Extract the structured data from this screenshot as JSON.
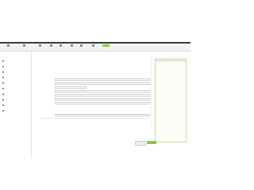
{
  "colors": {
    "accent": "#8cc63f",
    "header_strip": "#3a3a3a",
    "help_text": "#6a9a32",
    "help_border": "#c7dea6"
  },
  "toolbar": {
    "items": [
      {
        "label": "",
        "icon": "gear-icon"
      },
      {
        "label": "",
        "icon": "document-icon"
      },
      {
        "label": "",
        "icon": "calendar-icon"
      },
      {
        "label": "",
        "icon": "list-icon"
      },
      {
        "label": "",
        "icon": "folder-icon"
      },
      {
        "label": "",
        "icon": "chart-icon"
      },
      {
        "label": "",
        "icon": "plus-icon"
      },
      {
        "label": "",
        "icon": "user-icon"
      },
      {
        "label": "",
        "icon": "add-button-icon"
      }
    ]
  },
  "sidebar": {
    "title": "",
    "items": [
      {
        "label": ""
      },
      {
        "label": ""
      },
      {
        "label": ""
      },
      {
        "label": ""
      },
      {
        "label": ""
      },
      {
        "label": ""
      },
      {
        "label": ""
      },
      {
        "label": ""
      },
      {
        "label": ""
      },
      {
        "label": ""
      }
    ]
  },
  "main": {
    "title": "",
    "subtitle": "",
    "fields": [
      {
        "label": "",
        "value": ""
      },
      {
        "label": "",
        "value": ""
      },
      {
        "label": "",
        "value": ""
      },
      {
        "label": "",
        "value": ""
      },
      {
        "label": "",
        "value": ""
      },
      {
        "label": "",
        "value": ""
      },
      {
        "label": "",
        "value": ""
      },
      {
        "label": "",
        "value": ""
      },
      {
        "label": "",
        "value": ""
      },
      {
        "label": "",
        "value": ""
      },
      {
        "label": "",
        "value": ""
      },
      {
        "label": "",
        "value": ""
      },
      {
        "label": "",
        "value": ""
      }
    ]
  },
  "help": {
    "title": "",
    "lines": [
      "",
      "",
      "",
      "",
      ""
    ]
  },
  "actions": {
    "cancel_label": "",
    "save_label": ""
  }
}
